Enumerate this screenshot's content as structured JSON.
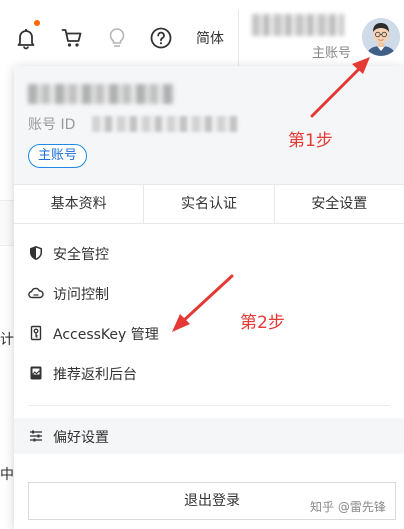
{
  "topbar": {
    "lang_label": "简体",
    "account_role": "主账号",
    "icons": [
      "bell-icon",
      "cart-icon",
      "lightbulb-icon",
      "help-icon"
    ],
    "notification_dot_color": "#ff6a00"
  },
  "left_page": {
    "fragment_1": "计",
    "fragment_2": "中"
  },
  "panel": {
    "account_id_label": "账号 ID",
    "role_badge": "主账号",
    "tabs": [
      "基本资料",
      "实名认证",
      "安全设置"
    ],
    "menu": [
      {
        "label": "安全管控",
        "icon": "shield-icon"
      },
      {
        "label": "访问控制",
        "icon": "cloud-icon"
      },
      {
        "label": "AccessKey 管理",
        "icon": "key-icon"
      },
      {
        "label": "推荐返利后台",
        "icon": "referral-icon"
      }
    ],
    "preferences": {
      "label": "偏好设置",
      "icon": "sliders-icon"
    },
    "logout_label": "退出登录"
  },
  "annotations": {
    "step1": "第1步",
    "step2": "第2步",
    "color": "#e53935"
  },
  "watermark": "知乎 @雷先锋",
  "colors": {
    "accent_blue": "#1e6fd9",
    "panel_header_bg": "#f5f6f8"
  }
}
